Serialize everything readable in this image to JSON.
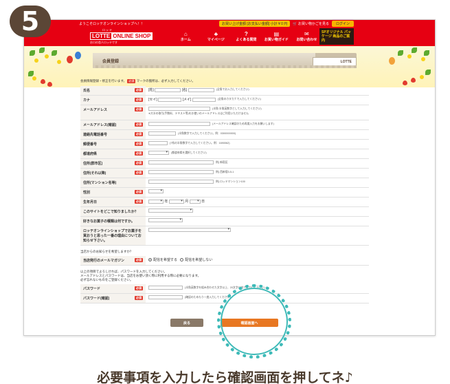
{
  "step": {
    "number": "5"
  },
  "site": {
    "welcome": "ようこそロッテオンラインショップへ！！",
    "cart_pill": "お買い上げ金額 [お支払い金額] 小計 ¥ 0 円",
    "cart_link": "お買い物かごを見る",
    "login": "ログイン",
    "logo_small": "ロッテ",
    "logo_lotte": "LOTTE",
    "logo_online": "ONLINE SHOP",
    "logo_tag": "お口の恋人ロッテです",
    "nav": [
      {
        "icon": "home-icon",
        "glyph": "⌂",
        "label": "ホーム"
      },
      {
        "icon": "mypage-icon",
        "glyph": "♣",
        "label": "マイページ"
      },
      {
        "icon": "faq-icon",
        "glyph": "?",
        "label": "よくある質問"
      },
      {
        "icon": "guide-icon",
        "glyph": "▤",
        "label": "お買い物ガイド"
      },
      {
        "icon": "contact-icon",
        "glyph": "✉",
        "label": "お問い合わせ"
      }
    ],
    "sp_badge": "SPオリジナル パッケージ 商品のご案内"
  },
  "page": {
    "title": "会員登録",
    "ribbon": "LOTTE"
  },
  "form": {
    "intro_before": "会員情報登録・修正を行います。",
    "required_mark": "必須",
    "intro_after": "マークの箇所は、必ず入力してください。",
    "fields": [
      {
        "label": "氏名",
        "required": true,
        "prefix1": "[姓]",
        "prefix2": "[名]",
        "note": "(全角でお入力してください)"
      },
      {
        "label": "カナ",
        "required": true,
        "prefix1": "[セイ]",
        "prefix2": "[メイ]",
        "note": "(全角のカタカナで入力してください)"
      },
      {
        "label": "メールアドレス",
        "required": true,
        "note": "(半角 半角英数字として入力してください)",
        "subnote": "※大半の取引(手数料、テキスト等)をお使いのメールアドレスはご利用いただけません"
      },
      {
        "label": "メールアドレス(確認)",
        "required": true,
        "note": "(メールアドレス確認のため再度入力をお願いします)"
      },
      {
        "label": "連絡先電話番号",
        "required": true,
        "note": "(半角数字で入力してください。例：0300000000)"
      },
      {
        "label": "郵便番号",
        "required": true,
        "note": "(7桁の半角数字で入力してください。例：1690062)"
      },
      {
        "label": "都道府県",
        "required": true,
        "note": "(都道府県を選択してください)"
      },
      {
        "label": "住所(群市区)",
        "required": true,
        "note": "例) 新宿区"
      },
      {
        "label": "住所(それ以降)",
        "required": true,
        "note": "例) 西新宿3-5-1"
      },
      {
        "label": "住所(マンション名等)",
        "required": false,
        "note": "例) ロッテマンション100"
      },
      {
        "label": "性別",
        "required": true
      },
      {
        "label": "生年月日",
        "required": true,
        "year": "年",
        "month": "月",
        "day": "日"
      },
      {
        "label": "このサイトをどこで知りましたか？",
        "required": false
      },
      {
        "label": "好きなお菓子の種類は何ですか。",
        "required": false
      },
      {
        "label": "ロッテオンラインショップでお菓子を買おうと思った一番の理由についてお知らせ下さい。",
        "required": false
      }
    ],
    "mail_question": "当店からのお知らせを希望しますか？",
    "mailmag": {
      "label": "当店発行のメールマガジン",
      "opt_yes": "配信を希望する",
      "opt_no": "配信を希望しない"
    },
    "password_intro": [
      "以上の項目でよろしければ、パスワードを入力してください。",
      "メールアドレスとパスワードは、当店をお使い頂く際に利用する際に必要になります。",
      "必ず忘れないものをご登録ください。"
    ],
    "password": {
      "label": "パスワード",
      "note": "(半角英数字を組み合わせた文字以上、20文字以内で入力して下さい)"
    },
    "password_confirm": {
      "label": "パスワード(確認)",
      "note": "(確認のためもう一度入力してください)"
    },
    "back_button": "戻る",
    "confirm_button": "確認画面へ"
  },
  "caption": "必要事項を入力したら確認画面を押してネ♪",
  "colors": {
    "brand_red": "#e60012",
    "accent_orange": "#e87722",
    "highlight_teal": "#3ebab8"
  }
}
